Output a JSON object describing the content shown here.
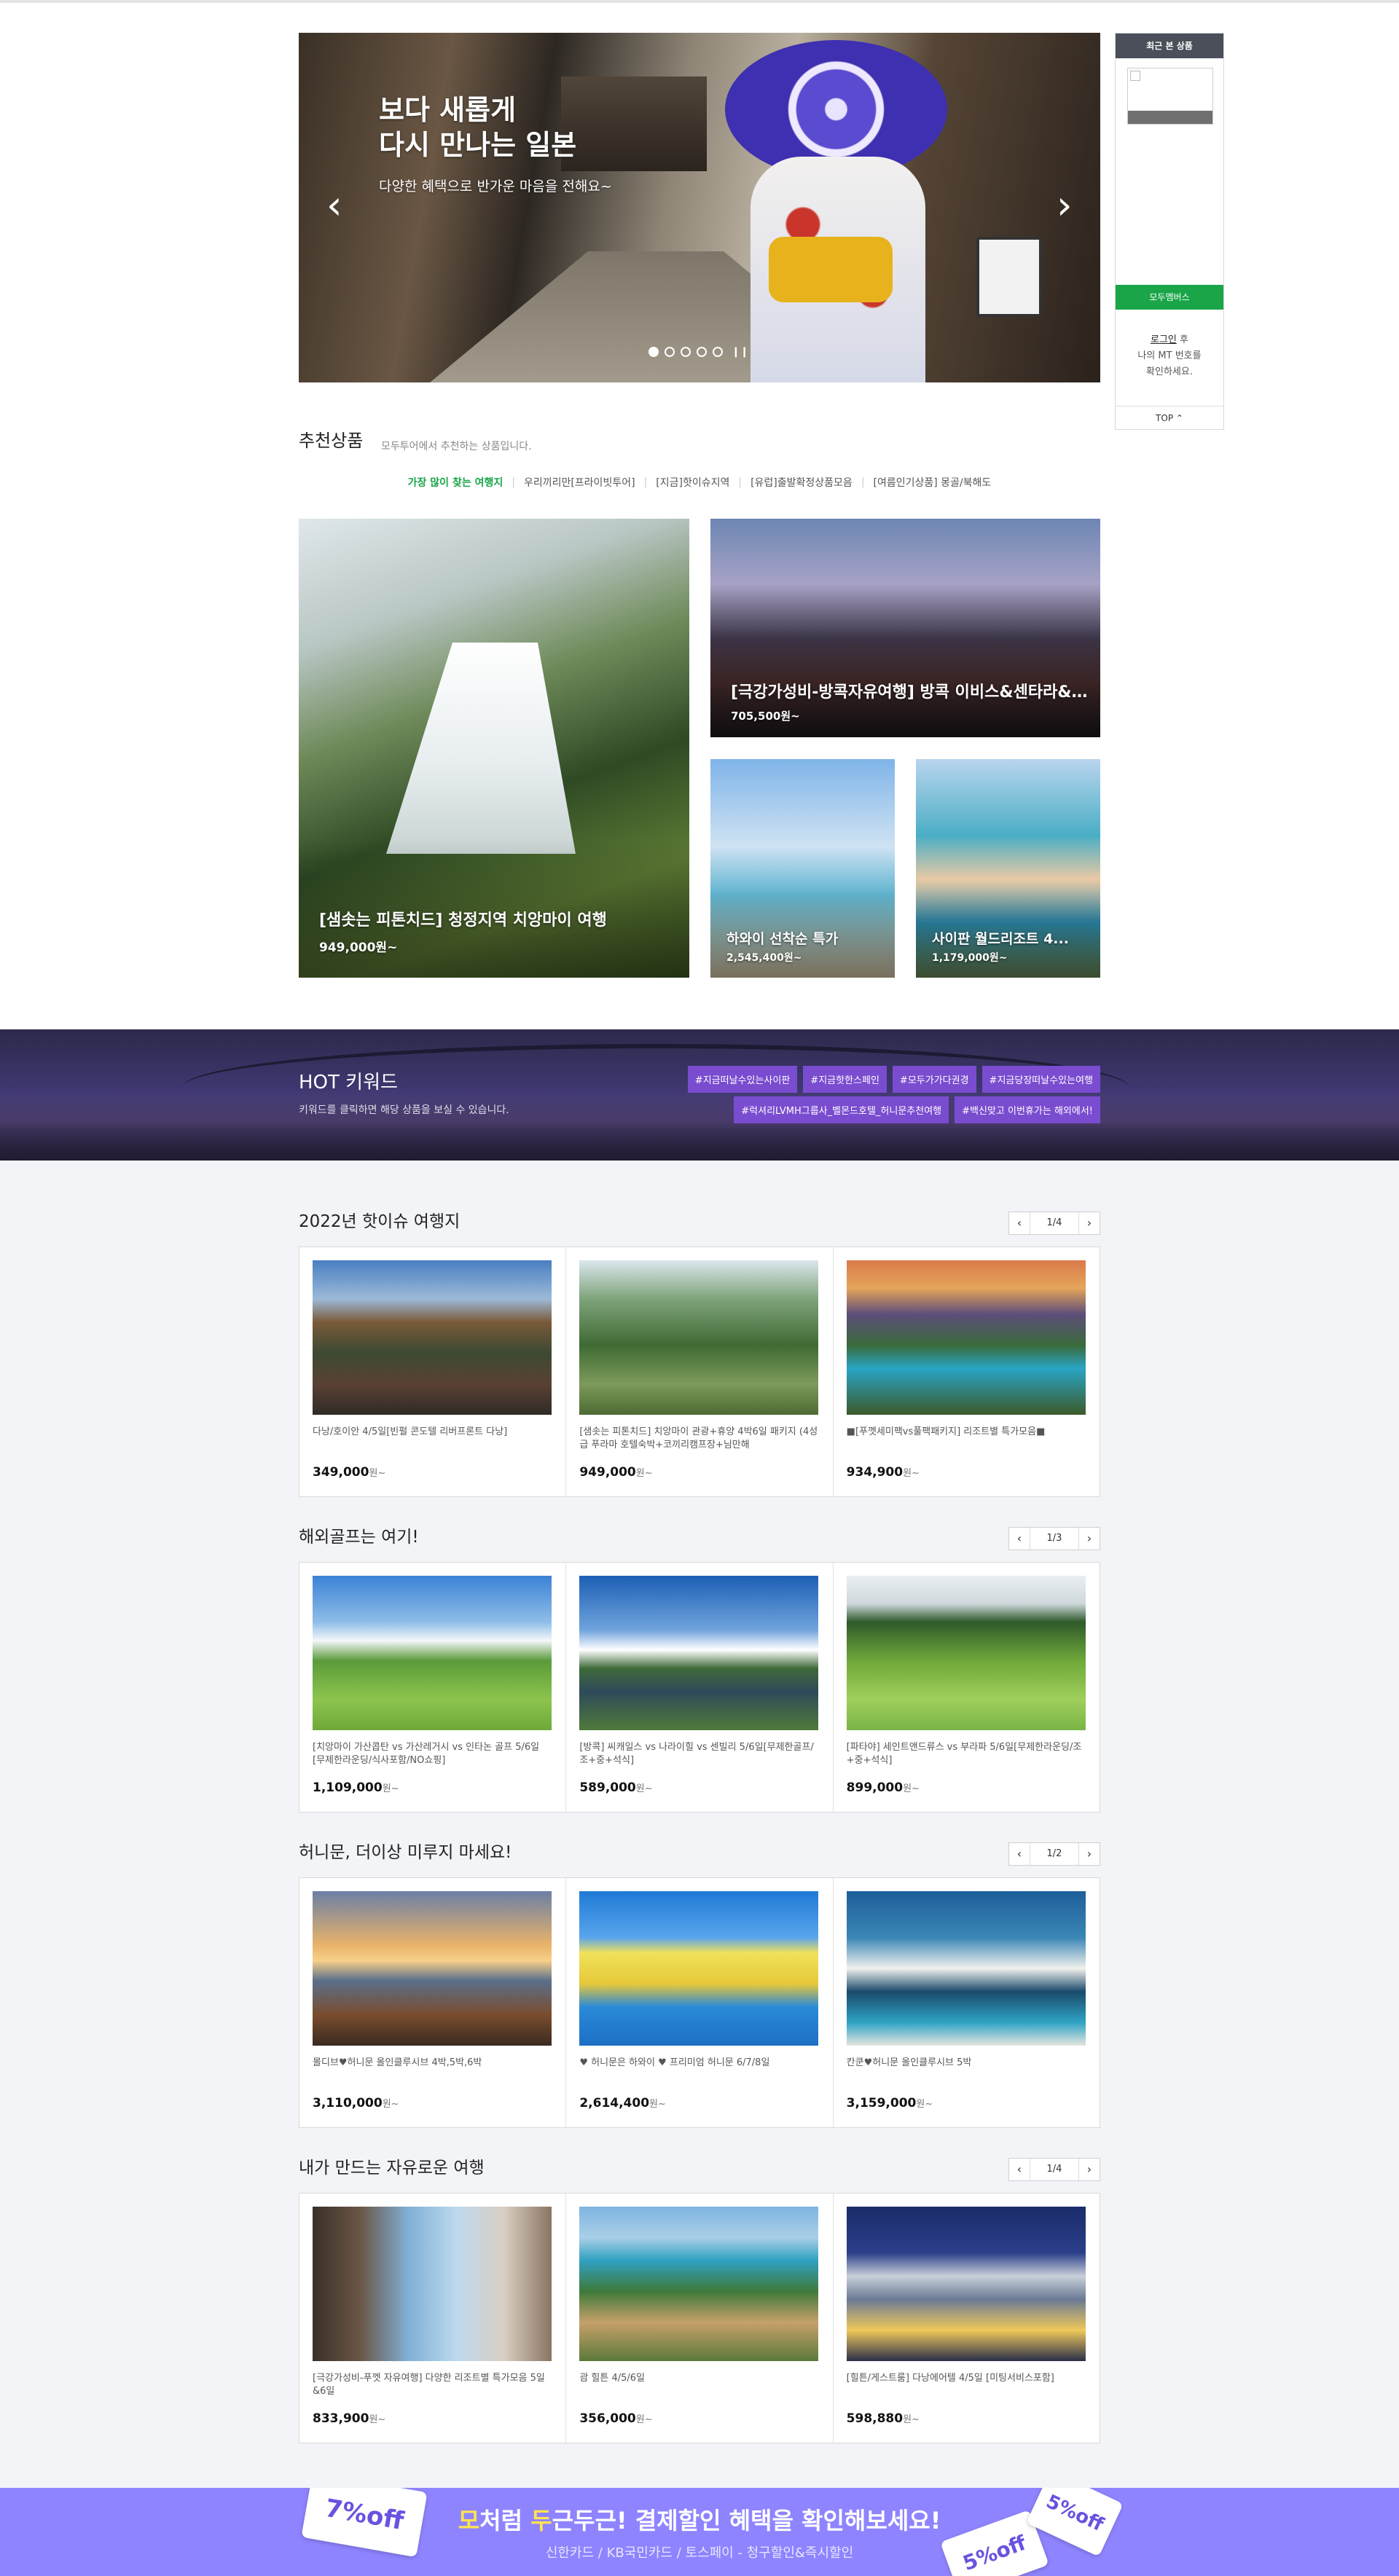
{
  "hero": {
    "title_line1": "보다 새롭게",
    "title_line2": "다시 만나는 일본",
    "subtitle": "다양한 혜택으로 반가운 마음을 전해요~",
    "prev_label": "‹",
    "next_label": "›",
    "slide_count": 5,
    "active_slide": 1,
    "pause_label": "❙❙"
  },
  "sidebar": {
    "header": "최근 본 상품",
    "modu_label": "모두멤버스",
    "login_link": "로그인",
    "login_suffix": " 후",
    "login_line2": "나의 MT 번호를",
    "login_line3": "확인하세요.",
    "top_label": "TOP ⌃"
  },
  "recommend": {
    "title": "추천상품",
    "desc": "모두투어에서 추천하는 상품입니다.",
    "tabs": [
      "가장 많이 찾는 여행지",
      "우리끼리만[프라이빗투어]",
      "[지금]핫이슈지역",
      "[유럽]출발확정상품모음",
      "[여름인기상품] 몽골/북해도"
    ],
    "cards": [
      {
        "title": "[샘솟는 피톤치드] 청정지역 치앙마이 여행",
        "price": "949,000원~"
      },
      {
        "title": "[극강가성비-방콕자유여행] 방콕 이비스&센타라&머...",
        "price": "705,500원~"
      },
      {
        "title": "하와이 선착순 특가",
        "price": "2,545,400원~"
      },
      {
        "title": "사이판 월드리조트 4...",
        "price": "1,179,000원~"
      }
    ]
  },
  "hot": {
    "title": "HOT 키워드",
    "desc": "키워드를 클릭하면 해당 상품을 보실 수 있습니다.",
    "row1": [
      "#지금떠날수있는사이판",
      "#지금핫한스페인",
      "#모두가가다권경",
      "#지금당장떠날수있는여행"
    ],
    "row2": [
      "#럭셔리LVMH그룹사_벨몬드호텔_허니문추천여행",
      "#백신맞고 이번휴가는 해외에서!"
    ]
  },
  "lists": [
    {
      "title": "2022년 핫이슈 여행지",
      "page": "1/4",
      "items": [
        {
          "name": "다낭/호이안 4/5일[빈펄 콘도텔 리버프론트 다낭]",
          "price": "349,000",
          "unit": "원~"
        },
        {
          "name": "[샘솟는 피톤치드] 치앙마이 관광+휴양 4박6일 패키지 (4성급 푸라마 호텔숙박+코끼리캠프장+님만해",
          "price": "949,000",
          "unit": "원~"
        },
        {
          "name": "■[푸껫세미팩vs풀팩패키지] 리조트별 특가모음■",
          "price": "934,900",
          "unit": "원~"
        }
      ]
    },
    {
      "title": "해외골프는 여기!",
      "page": "1/3",
      "items": [
        {
          "name": "[치앙마이 가산콥탄 vs 가산레거시 vs 인타논 골프 5/6일 [무제한라운딩/식사포함/NO쇼핑]",
          "price": "1,109,000",
          "unit": "원~"
        },
        {
          "name": "[방콕] 씨캐일스 vs 나라이힐 vs 센빌리 5/6일[무제한골프/조+중+석식]",
          "price": "589,000",
          "unit": "원~"
        },
        {
          "name": "[파타야] 세인트앤드류스 vs 부라파 5/6일[무제한라운딩/조+중+석식]",
          "price": "899,000",
          "unit": "원~"
        }
      ]
    },
    {
      "title": "허니문, 더이상 미루지 마세요!",
      "page": "1/2",
      "items": [
        {
          "name": "몰디브♥허니문 올인클루시브 4박,5박,6박",
          "price": "3,110,000",
          "unit": "원~"
        },
        {
          "name": "♥ 허니문은 하와이 ♥ 프리미엄 허니문 6/7/8일",
          "price": "2,614,400",
          "unit": "원~"
        },
        {
          "name": "칸쿤♥허니문 올인클루시브 5박",
          "price": "3,159,000",
          "unit": "원~"
        }
      ]
    },
    {
      "title": "내가 만드는 자유로운 여행",
      "page": "1/4",
      "items": [
        {
          "name": "[극강가성비-푸껫 자유여행] 다양한 리조트별 특가모음 5일&6일",
          "price": "833,900",
          "unit": "원~"
        },
        {
          "name": "괌 힐튼 4/5/6일",
          "price": "356,000",
          "unit": "원~"
        },
        {
          "name": "[힐튼/게스트룸] 다낭에어텔 4/5일 [미팅서비스포함]",
          "price": "598,880",
          "unit": "원~"
        }
      ]
    }
  ],
  "banner": {
    "title_hl1": "모",
    "title_part1": "처럼 ",
    "title_hl2": "두",
    "title_part2": "근두근! 결제할인 혜택을 확인해보세요!",
    "subtitle": "신한카드 / KB국민카드 / 토스페이 - 청구할인&즉시할인",
    "ticket1": "7%off",
    "ticket2": "5%off",
    "ticket3": "5%off"
  },
  "colors": {
    "accent": "#19a548",
    "keyword_bg": "#7a4cd0",
    "banner_bg": "#8f84ff"
  }
}
